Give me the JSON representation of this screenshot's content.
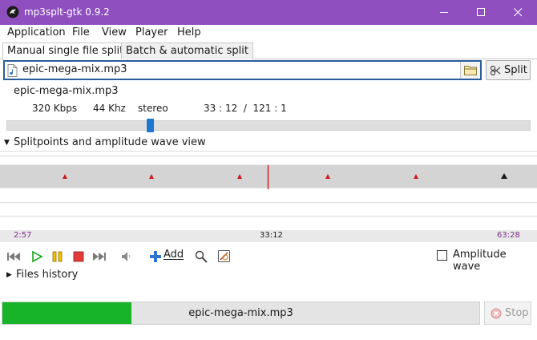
{
  "window": {
    "title": "mp3splt-gtk 0.9.2",
    "app_icon": "mp3splt-icon",
    "titlebar_color": "#8f4fbf"
  },
  "menu": [
    "Application",
    "File",
    "View",
    "Player",
    "Help"
  ],
  "tabs": [
    {
      "label": "Manual single file split",
      "active": true
    },
    {
      "label": "Batch & automatic split",
      "active": false
    }
  ],
  "file_input": {
    "value": "epic-mega-mix.mp3",
    "browse_icon": "folder-icon"
  },
  "split_button": {
    "label": "Split",
    "icon": "split-icon"
  },
  "file_info": {
    "name": "epic-mega-mix.mp3",
    "bitrate": "320 Kbps",
    "frequency": "44 Khz",
    "mode": "stereo",
    "position": "33 : 12  /  121 : 1"
  },
  "seek": {
    "fraction": 0.275
  },
  "wave_panel": {
    "label": "Splitpoints and amplitude wave view"
  },
  "timeline": {
    "start": "2:57",
    "current": "33:12",
    "end": "63:28",
    "marker_color": "#cc1a1a",
    "cursor_color": "#d42020"
  },
  "player": {
    "buttons": [
      "previous-icon",
      "play-icon",
      "pause-icon",
      "stop-icon",
      "next-icon",
      "volume-icon"
    ],
    "add_label": "Add",
    "amplitude_label": "Amplitude wave",
    "amplitude_checked": false
  },
  "files_history": {
    "label": "Files history"
  },
  "progress": {
    "fraction": 0.27,
    "text": "epic-mega-mix.mp3"
  },
  "stop_button": {
    "label": "Stop",
    "enabled": false
  }
}
